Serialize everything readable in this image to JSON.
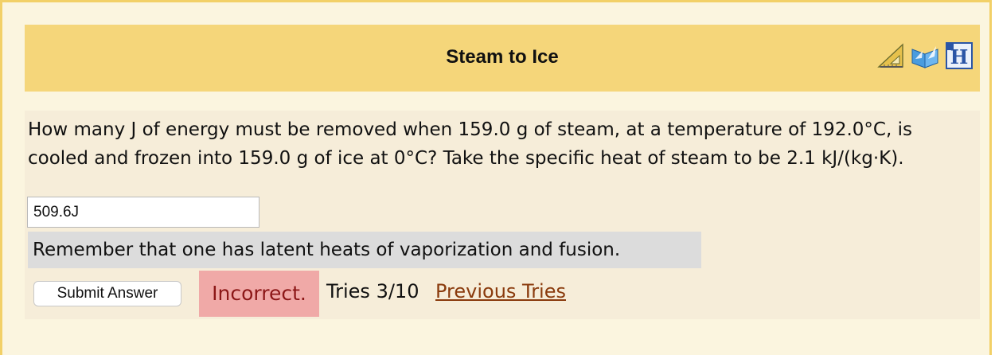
{
  "header": {
    "title": "Steam to Ice",
    "icons": [
      "triangle-ruler-icon",
      "book-icon",
      "help-icon"
    ]
  },
  "question": {
    "text": "How many J of energy must be removed when 159.0 g of steam, at a temperature of 192.0°C, is cooled and frozen into 159.0 g of ice at 0°C? Take the specific heat of steam to be 2.1 kJ/(kg·K)."
  },
  "answer": {
    "value": "509.6J"
  },
  "hint": {
    "text": "Remember that one has latent heats of vaporization and fusion."
  },
  "submit": {
    "label": "Submit Answer"
  },
  "status": {
    "text": "Incorrect.",
    "tries_text": "Tries 3/10",
    "previous_tries_label": "Previous Tries"
  },
  "colors": {
    "header_bg": "#f5d67a",
    "outer_bg": "#fbf5df",
    "incorrect_bg": "#f0a9a7",
    "link": "#8a3b0d"
  }
}
